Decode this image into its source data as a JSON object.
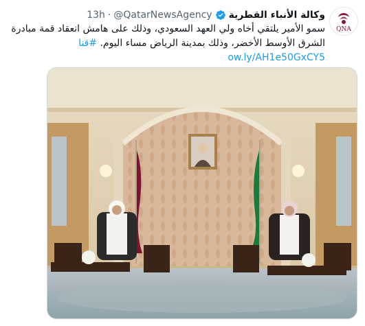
{
  "tweet": {
    "author_name": "وكالة الأنباء القطرية",
    "handle": "@QatarNewsAgency",
    "separator": "·",
    "time": "13h",
    "avatar_label": "QNA",
    "text_line1": "سمو الأمير يلتقي أخاه ولي العهد السعودي،  وذلك على هامش انعقاد قمة مبادرة",
    "text_line2_part1": "الشرق الأوسط الأخضر، وذلك بمدينة الرياض مساء اليوم.",
    "hashtag": "#قنا",
    "link": "ow.ly/AH1e50GxCY5"
  },
  "colors": {
    "link": "#1d9bf0",
    "text": "#0f1419",
    "muted": "#536471",
    "verified": "#1d9bf0",
    "qna_maroon": "#8a1538"
  },
  "icons": {
    "verified": "verified-badge-icon"
  }
}
